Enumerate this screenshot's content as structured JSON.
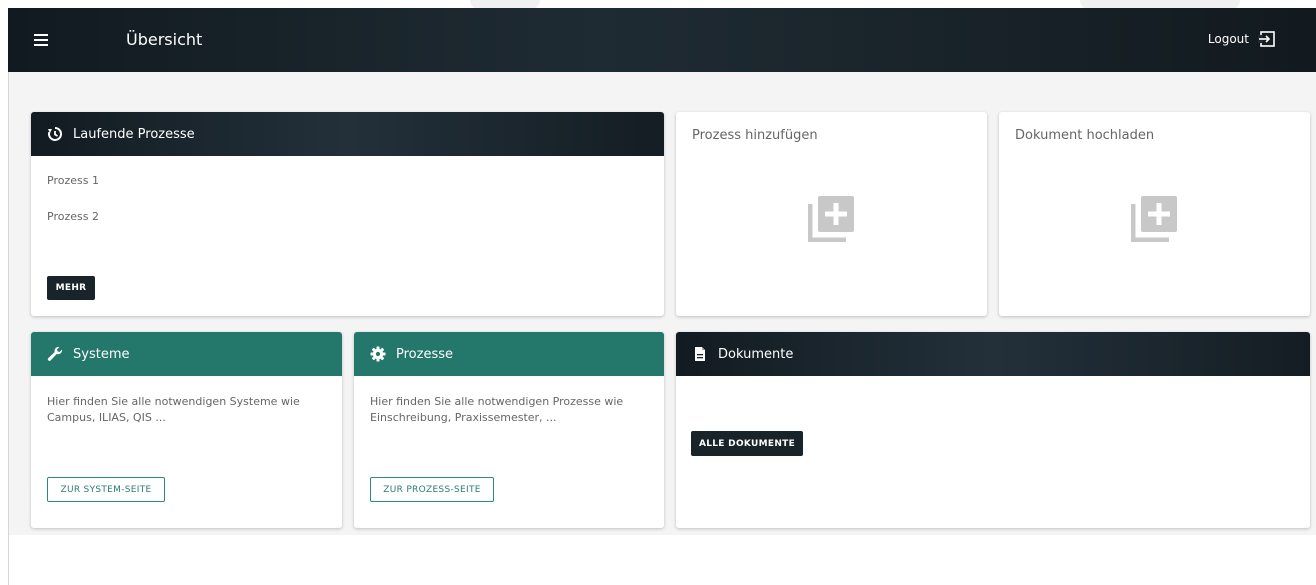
{
  "header": {
    "title": "Übersicht",
    "logout_label": "Logout",
    "icons": {
      "menu": "menu-icon",
      "logout": "logout-icon"
    }
  },
  "running": {
    "title": "Laufende Prozesse",
    "icon": "history-icon",
    "items": [
      "Prozess 1",
      "Prozess 2"
    ],
    "more_label": "MEHR"
  },
  "add_process": {
    "title": "Prozess hinzufügen",
    "icon": "add-to-collection-icon"
  },
  "upload_document": {
    "title": "Dokument hochladen",
    "icon": "add-to-collection-icon"
  },
  "systems": {
    "title": "Systeme",
    "icon": "wrench-icon",
    "description": "Hier finden Sie alle notwendigen Systeme wie\nCampus, ILIAS, QIS ...",
    "button_label": "ZUR SYSTEM-SEITE"
  },
  "processes": {
    "title": "Prozesse",
    "icon": "gear-icon",
    "description": "Hier finden Sie alle notwendigen Prozesse wie\nEinschreibung, Praxissemester, ...",
    "button_label": "ZUR PROZESS-SEITE"
  },
  "documents": {
    "title": "Dokumente",
    "icon": "document-icon",
    "button_label": "ALLE DOKUMENTE"
  },
  "colors": {
    "header_dark": "#19232a",
    "accent_green": "#23776b",
    "background": "#f4f4f4"
  }
}
